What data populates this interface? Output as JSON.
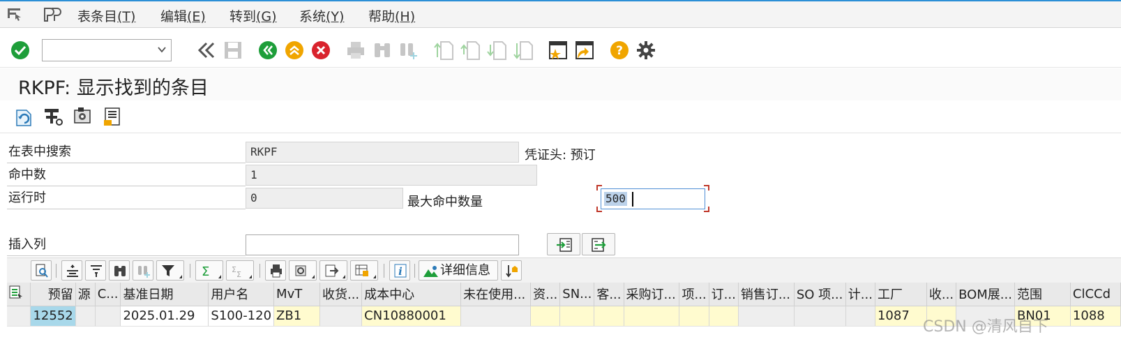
{
  "menubar": {
    "items": [
      {
        "label": "表条目",
        "key": "(T)"
      },
      {
        "label": "编辑",
        "key": "(E)"
      },
      {
        "label": "转到",
        "key": "(G)"
      },
      {
        "label": "系统",
        "key": "(Y)"
      },
      {
        "label": "帮助",
        "key": "(H)"
      }
    ]
  },
  "toolbar": {
    "command_value": "",
    "icons": [
      "enter-icon",
      "back-icon",
      "save-icon",
      "back-green-icon",
      "exit-up-icon",
      "cancel-icon",
      "print-icon",
      "find-icon",
      "find-next-icon",
      "first-page-icon",
      "prev-page-icon",
      "next-page-icon",
      "last-page-icon",
      "new-session-icon",
      "shortcut-icon",
      "help-icon",
      "settings-icon"
    ]
  },
  "title": "RKPF: 显示找到的条目",
  "form": {
    "search_in_table_label": "在表中搜索",
    "search_in_table_value": "RKPF",
    "table_description": "凭证头: 预订",
    "hit_count_label": "命中数",
    "hit_count_value": "1",
    "runtime_label": "运行时",
    "runtime_value": "0",
    "max_hits_label": "最大命中数量",
    "max_hits_value": "500",
    "insert_column_label": "插入列",
    "insert_column_value": ""
  },
  "grid_toolbar": {
    "detail_label": "详细信息"
  },
  "grid": {
    "columns": [
      "预留",
      "源",
      "C...",
      "基准日期",
      "用户名",
      "MvT",
      "收货...",
      "成本中心",
      "未在使用...",
      "资...",
      "SN...",
      "客...",
      "采购订...",
      "项...",
      "订...",
      "销售订...",
      "SO 项...",
      "计...",
      "工厂",
      "收...",
      "BOM展...",
      "范围",
      "ClCCd"
    ],
    "rows": [
      [
        "12552",
        "",
        "",
        "2025.01.29",
        "S100-120",
        "ZB1",
        "",
        "CN10880001",
        "",
        "",
        "",
        "",
        "",
        "",
        "",
        "",
        "",
        "",
        "1087",
        "",
        "",
        "BN01",
        "1088"
      ]
    ]
  },
  "watermark": "CSDN @清风自下"
}
